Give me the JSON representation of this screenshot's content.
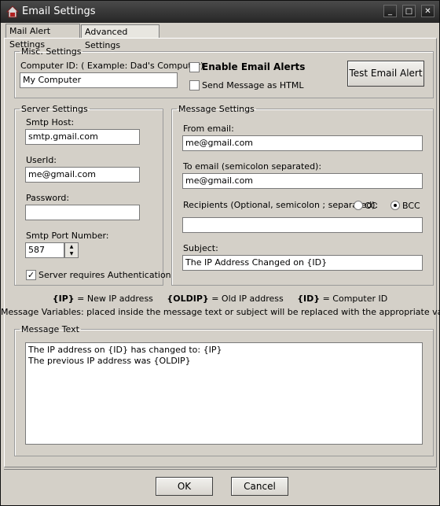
{
  "window": {
    "title": "Email Settings"
  },
  "tabs": [
    {
      "label": "Mail Alert Settings",
      "active": true
    },
    {
      "label": "Advanced Settings",
      "active": false
    }
  ],
  "misc": {
    "legend": "Misc. Settings",
    "computer_id_label": "Computer ID: ( Example: Dad's Computer)",
    "computer_id_value": "My Computer",
    "enable_alerts_label": "Enable Email Alerts",
    "enable_alerts_checked": false,
    "html_label": "Send Message as HTML",
    "html_checked": false,
    "test_button": "Test Email Alert"
  },
  "server": {
    "legend": "Server Settings",
    "host_label": "Smtp Host:",
    "host_value": "smtp.gmail.com",
    "userid_label": "UserId:",
    "userid_value": "me@gmail.com",
    "password_label": "Password:",
    "password_value": "",
    "port_label": "Smtp Port Number:",
    "port_value": "587",
    "auth_label": "Server requires Authentication",
    "auth_checked": true
  },
  "message": {
    "legend": "Message Settings",
    "from_label": "From email:",
    "from_value": "me@gmail.com",
    "to_label": "To email (semicolon separated):",
    "to_value": "me@gmail.com",
    "recipients_label": "Recipients (Optional, semicolon ; separated):",
    "cc_label": "CC",
    "bcc_label": "BCC",
    "selected_mode": "BCC",
    "recipients_value": "",
    "subject_label": "Subject:",
    "subject_value": "The IP Address Changed on {ID}"
  },
  "variables": {
    "ip_token": "{IP}",
    "ip_desc": " = New IP address",
    "oldip_token": "{OLDIP}",
    "oldip_desc": " = Old IP address",
    "id_token": "{ID}",
    "id_desc": " = Computer ID",
    "note": "Message Variables: placed inside the message text or subject will be replaced with the appropriate value."
  },
  "message_text": {
    "legend": "Message Text",
    "body": "The IP address on {ID} has changed to: {IP}\nThe previous IP address was {OLDIP}"
  },
  "footer": {
    "ok_label": "OK",
    "cancel_label": "Cancel"
  }
}
